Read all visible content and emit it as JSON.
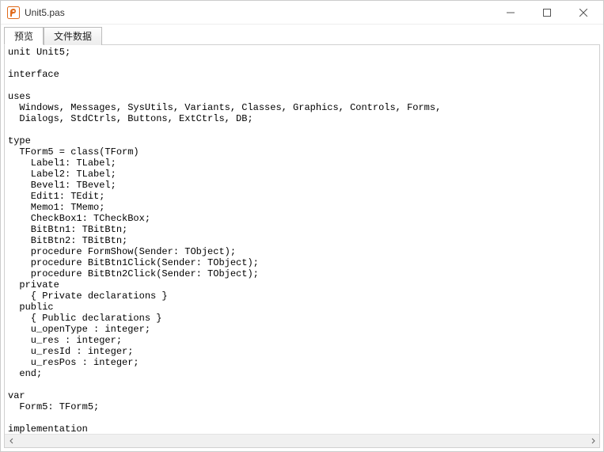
{
  "window": {
    "title": "Unit5.pas"
  },
  "tabs": {
    "t0": "预览",
    "t1": "文件数据"
  },
  "code": "unit Unit5;\n\ninterface\n\nuses\n  Windows, Messages, SysUtils, Variants, Classes, Graphics, Controls, Forms,\n  Dialogs, StdCtrls, Buttons, ExtCtrls, DB;\n\ntype\n  TForm5 = class(TForm)\n    Label1: TLabel;\n    Label2: TLabel;\n    Bevel1: TBevel;\n    Edit1: TEdit;\n    Memo1: TMemo;\n    CheckBox1: TCheckBox;\n    BitBtn1: TBitBtn;\n    BitBtn2: TBitBtn;\n    procedure FormShow(Sender: TObject);\n    procedure BitBtn1Click(Sender: TObject);\n    procedure BitBtn2Click(Sender: TObject);\n  private\n    { Private declarations }\n  public\n    { Public declarations }\n    u_openType : integer;\n    u_res : integer;\n    u_resId : integer;\n    u_resPos : integer;\n  end;\n\nvar\n  Form5: TForm5;\n\nimplementation\n\nuses DmUnit;\n\n{$R *.dfm}\n"
}
